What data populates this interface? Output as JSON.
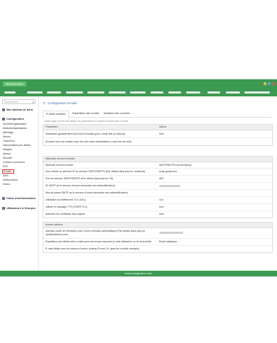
{
  "app": {
    "brand": "NextGestion"
  },
  "window": {
    "controls": [
      "#f4c542",
      "#5aa9e6",
      "#e05a5a"
    ]
  },
  "sidebar": {
    "search_placeholder": "Rechercher",
    "dashboard": "Mon tableau de bord",
    "config_header": "Configuration",
    "items": [
      "Société/Organisation",
      "Modules/Applications",
      "Affichage",
      "Menus",
      "Traduction",
      "Valeurs/filtres par défaut",
      "Widgets",
      "Alertes",
      "Sécurité",
      "Limites et précision",
      "PDF",
      "Emails",
      "SMS",
      "Dictionnaires",
      "Divers"
    ],
    "active_index": 11,
    "admin_tools": "Outils d'administration",
    "users_groups": "Utilisateurs & Groupes"
  },
  "page": {
    "title": "Configuration Emails",
    "tabs": [
      "E-mails sortants",
      "Expéditeur des emails",
      "Modèles des courriels"
    ],
    "active_tab": 0,
    "description": "Cette page permet de définir les paramètres et options d'envoi des e-mails"
  },
  "sections": [
    {
      "header": "Paramètre",
      "header_value": "Valeur",
      "rows": [
        {
          "label": "Désactiver globalement tout envoi d'emails (pour mode test ou démos)",
          "value": "Non"
        },
        {
          "label": "Envoyer tous les emails à (au lieu des vrais destinataires, à des fins de test)",
          "value": ""
        }
      ]
    },
    {
      "header": "Méthode d'envoi d'email",
      "header_value": "",
      "rows": [
        {
          "label": "Méthode d'envoi d'email",
          "value": "SMTP/SMTPS socket library"
        },
        {
          "label": "Nom d'hôte ou adresse IP du serveur SMTP/SMTPS (Par défaut dans php.ini: localhost)",
          "value": "smtp.gmail.com"
        },
        {
          "label": "Port du serveur SMTP/SMTPS (Par défaut dans php.ini: 25)",
          "value": "465"
        },
        {
          "label": "ID SMTP (si le serveur d'envoi nécessite une authentification)",
          "value": ""
        },
        {
          "label": "Mot de passe SMTP (si le serveur d'envoi nécessite une authentification)",
          "value": ""
        },
        {
          "label": "Utilisation du chiffrement TLS (SSL)",
          "value": "Oui"
        },
        {
          "label": "Utiliser le cryptage TTS (STARTTLS)",
          "value": "Non"
        },
        {
          "label": "Autoriser les certificats auto-signés",
          "value": "Non"
        }
      ]
    },
    {
      "header": "Autres options",
      "header_value": "",
      "rows": [
        {
          "label": "Adresse email de l'émetteur pour l'envoi d'emails automatiques (Par défaut dans php.ini: me@localhost.com)",
          "value": ""
        },
        {
          "label": "Expéditeur par défaut des e-mails pour les envois manuels (e-mail utilisateur ou de la société)",
          "value": "Email utilisateur"
        },
        {
          "label": "E-mail utilisé pour les retours d'erreur (champ 'Errors-To' dans les e-mails envoyés)",
          "value": ""
        }
      ]
    }
  ],
  "footer": {
    "text": "www.nextgestion.com"
  },
  "colors": {
    "accent": "#3d9a52",
    "active_border": "#d42a2a",
    "title": "#3b6ea5"
  }
}
